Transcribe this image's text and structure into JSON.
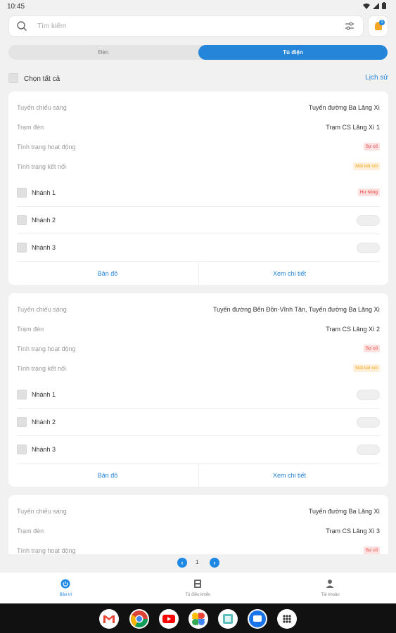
{
  "status_bar": {
    "time": "10:45"
  },
  "search": {
    "placeholder": "Tìm kiếm",
    "notification_count": "1"
  },
  "tabs": [
    {
      "label": "Đèn",
      "active": false
    },
    {
      "label": "Tủ điện",
      "active": true
    }
  ],
  "select_all_label": "Chọn tất cả",
  "history_label": "Lịch sử",
  "field_labels": {
    "route": "Tuyến chiếu sáng",
    "station": "Trạm đèn",
    "operation": "Tình trạng hoạt động",
    "connection": "Tình trạng kết nối"
  },
  "cards": [
    {
      "route": "Tuyến đường Ba Lăng Xì",
      "station": "Trạm CS Lăng Xì 1",
      "operation": "Sự cố",
      "connection": "Mất kết nối",
      "branches": [
        {
          "label": "Nhánh 1",
          "status": "Hư hỏng"
        },
        {
          "label": "Nhánh 2",
          "status": ""
        },
        {
          "label": "Nhánh 3",
          "status": ""
        }
      ],
      "map_label": "Bản đồ",
      "detail_label": "Xem chi tiết"
    },
    {
      "route": "Tuyến đường Bến Đồn-Vĩnh Tân, Tuyến đường Ba Lăng Xì",
      "station": "Trạm CS Lăng Xì 2",
      "operation": "Sự cố",
      "connection": "Mất kết nối",
      "branches": [
        {
          "label": "Nhánh 1",
          "status": ""
        },
        {
          "label": "Nhánh 2",
          "status": ""
        },
        {
          "label": "Nhánh 3",
          "status": ""
        }
      ],
      "map_label": "Bản đồ",
      "detail_label": "Xem chi tiết"
    },
    {
      "route": "Tuyến đường Ba Lăng Xì",
      "station": "Trạm CS Lăng Xì 3",
      "operation": "Sự cố"
    }
  ],
  "pagination": {
    "current_page": "1"
  },
  "bottom_nav": [
    {
      "label": "Bảo trì",
      "icon": "power-icon",
      "active": true
    },
    {
      "label": "Tủ điều khiển",
      "icon": "cabinet-icon",
      "active": false
    },
    {
      "label": "Tài khoản",
      "icon": "person-icon",
      "active": false
    }
  ],
  "dock_apps": [
    "gmail-icon",
    "chrome-icon",
    "youtube-icon",
    "photos-icon",
    "files-icon",
    "messages-icon",
    "app-drawer-icon"
  ],
  "colors": {
    "accent": "#2585d8",
    "error": "#e53935",
    "warning": "#f5a623"
  }
}
